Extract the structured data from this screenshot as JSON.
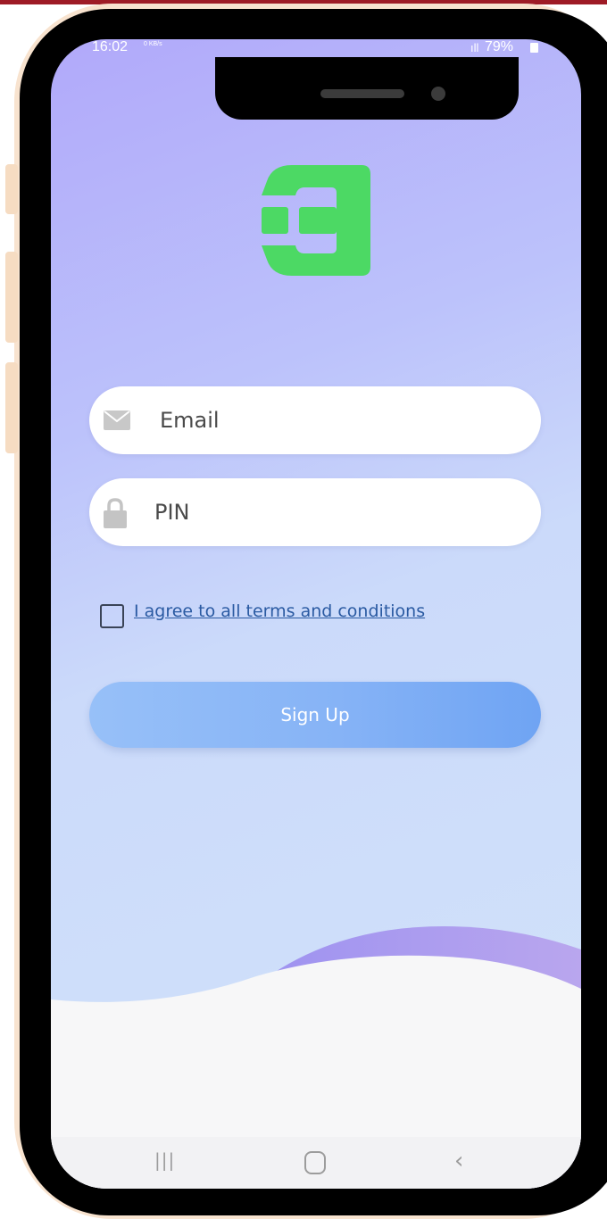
{
  "status_bar": {
    "time": "16:02",
    "net_speed": "0 KB/s",
    "signal": "ıll",
    "battery": "79%"
  },
  "login": {
    "email_placeholder": "Email",
    "pin_placeholder": "PIN",
    "terms_label": "I agree to all terms and conditions",
    "terms_checked": false,
    "signup_label": "Sign Up"
  },
  "nav_bar": {
    "recent": "|||",
    "back": "‹"
  },
  "colors": {
    "logo": "#4cd964",
    "accent": "#78aaf4",
    "frame": "#000000",
    "frame_edge": "#f8e3cf"
  },
  "icons": [
    "mail-icon",
    "lock-icon",
    "recent-apps-icon",
    "home-icon",
    "back-icon"
  ]
}
